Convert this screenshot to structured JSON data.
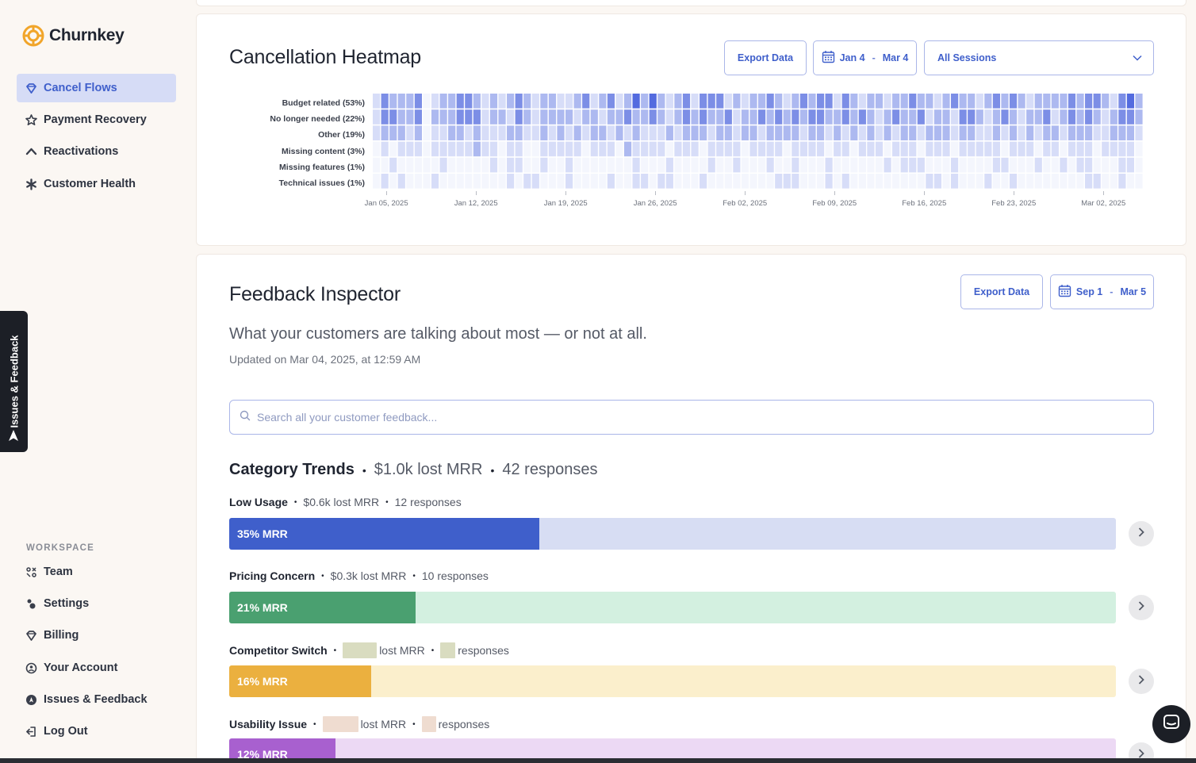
{
  "app": {
    "name": "Churnkey"
  },
  "sidebar": {
    "items": [
      {
        "label": "Cancel Flows",
        "icon": "diamond-icon",
        "active": true
      },
      {
        "label": "Payment Recovery",
        "icon": "star-badge-icon"
      },
      {
        "label": "Reactivations",
        "icon": "arrow-up-icon"
      },
      {
        "label": "Customer Health",
        "icon": "asterisk-icon"
      }
    ],
    "workspace_label": "WORKSPACE",
    "workspace_items": [
      {
        "label": "Team",
        "icon": "team-icon"
      },
      {
        "label": "Settings",
        "icon": "settings-icon"
      },
      {
        "label": "Billing",
        "icon": "gem-icon"
      },
      {
        "label": "Your Account",
        "icon": "account-icon"
      },
      {
        "label": "Issues & Feedback",
        "icon": "feedback-icon"
      },
      {
        "label": "Log Out",
        "icon": "logout-icon"
      }
    ]
  },
  "feedback_tab": {
    "label": "Issues & Feedback"
  },
  "heatmap": {
    "title": "Cancellation Heatmap",
    "export_label": "Export Data",
    "date_from": "Jan 4",
    "date_sep": "-",
    "date_to": "Mar 4",
    "sessions_value": "All Sessions",
    "accent": "#4a63dd"
  },
  "chart_data": {
    "type": "heatmap",
    "rows": [
      "Budget related (53%)",
      "No longer needed (22%)",
      "Other (19%)",
      "Missing content (3%)",
      "Missing features (1%)",
      "Technical issues (1%)"
    ],
    "x_ticks": [
      "Jan 05, 2025",
      "Jan 12, 2025",
      "Jan 19, 2025",
      "Jan 26, 2025",
      "Feb 02, 2025",
      "Feb 09, 2025",
      "Feb 16, 2025",
      "Feb 23, 2025",
      "Mar 02, 2025"
    ],
    "x_start": "Jan 04, 2025",
    "x_end": "Mar 04, 2025",
    "values": [
      [
        1,
        3,
        2,
        2,
        2,
        3,
        0,
        1,
        2,
        2,
        3,
        3,
        2,
        1,
        2,
        1,
        2,
        3,
        2,
        1,
        2,
        2,
        1,
        1,
        2,
        3,
        1,
        2,
        3,
        1,
        2,
        4,
        2,
        4,
        2,
        1,
        2,
        3,
        1,
        3,
        3,
        3,
        1,
        2,
        1,
        2,
        2,
        3,
        2,
        1,
        2,
        3,
        2,
        3,
        3,
        1,
        3,
        2,
        1,
        2,
        2,
        1,
        2,
        2,
        3,
        2,
        2,
        1,
        2,
        3,
        2,
        2,
        1,
        2,
        3,
        2,
        3,
        2,
        1,
        2,
        2,
        2,
        2,
        3,
        2,
        3,
        3,
        2,
        1,
        3,
        4,
        2
      ],
      [
        1,
        3,
        3,
        2,
        2,
        3,
        0,
        2,
        2,
        2,
        3,
        3,
        3,
        1,
        2,
        2,
        1,
        3,
        2,
        1,
        2,
        2,
        2,
        2,
        1,
        2,
        2,
        1,
        2,
        2,
        3,
        2,
        2,
        3,
        2,
        1,
        2,
        3,
        2,
        3,
        2,
        2,
        3,
        1,
        2,
        2,
        3,
        2,
        3,
        2,
        3,
        2,
        3,
        3,
        2,
        2,
        3,
        2,
        3,
        2,
        1,
        2,
        3,
        2,
        2,
        3,
        1,
        2,
        2,
        1,
        3,
        3,
        2,
        1,
        2,
        3,
        2,
        1,
        2,
        2,
        3,
        1,
        2,
        3,
        2,
        3,
        2,
        1,
        2,
        3,
        3,
        2
      ],
      [
        1,
        2,
        2,
        2,
        1,
        2,
        0,
        1,
        1,
        2,
        2,
        1,
        2,
        1,
        1,
        1,
        2,
        2,
        1,
        1,
        2,
        1,
        2,
        1,
        2,
        1,
        2,
        2,
        1,
        2,
        1,
        2,
        1,
        1,
        1,
        2,
        1,
        2,
        2,
        2,
        1,
        2,
        2,
        1,
        2,
        2,
        1,
        2,
        2,
        2,
        2,
        1,
        2,
        2,
        1,
        2,
        1,
        2,
        1,
        2,
        1,
        2,
        1,
        2,
        2,
        1,
        2,
        2,
        2,
        1,
        2,
        2,
        1,
        1,
        2,
        1,
        2,
        1,
        2,
        1,
        2,
        2,
        1,
        2,
        2,
        2,
        1,
        1,
        2,
        2,
        2,
        1
      ],
      [
        0,
        1,
        0,
        1,
        1,
        1,
        0,
        1,
        1,
        1,
        1,
        1,
        2,
        1,
        1,
        0,
        1,
        1,
        0,
        0,
        1,
        1,
        1,
        1,
        1,
        0,
        1,
        1,
        1,
        0,
        2,
        1,
        1,
        1,
        1,
        0,
        1,
        1,
        1,
        0,
        1,
        1,
        1,
        1,
        0,
        1,
        1,
        1,
        1,
        0,
        1,
        1,
        1,
        1,
        0,
        1,
        1,
        0,
        1,
        1,
        1,
        0,
        1,
        1,
        1,
        0,
        1,
        1,
        1,
        0,
        1,
        1,
        1,
        1,
        1,
        0,
        1,
        1,
        1,
        0,
        1,
        1,
        0,
        1,
        1,
        1,
        0,
        1,
        1,
        1,
        1,
        0
      ],
      [
        0,
        0,
        1,
        0,
        0,
        0,
        0,
        0,
        1,
        0,
        0,
        0,
        0,
        0,
        1,
        0,
        1,
        1,
        0,
        0,
        1,
        0,
        0,
        1,
        0,
        0,
        0,
        0,
        0,
        0,
        0,
        1,
        0,
        0,
        0,
        1,
        0,
        0,
        0,
        0,
        1,
        0,
        0,
        1,
        0,
        0,
        0,
        1,
        0,
        0,
        1,
        0,
        0,
        0,
        1,
        0,
        0,
        0,
        0,
        0,
        0,
        1,
        0,
        1,
        1,
        1,
        0,
        0,
        0,
        1,
        0,
        0,
        0,
        0,
        1,
        1,
        0,
        0,
        0,
        1,
        0,
        0,
        1,
        0,
        1,
        1,
        0,
        0,
        0,
        1,
        1,
        0
      ],
      [
        0,
        1,
        0,
        1,
        0,
        0,
        0,
        1,
        0,
        0,
        0,
        0,
        0,
        0,
        0,
        0,
        1,
        0,
        1,
        1,
        0,
        0,
        0,
        1,
        0,
        0,
        0,
        0,
        1,
        0,
        0,
        1,
        1,
        0,
        1,
        1,
        0,
        0,
        0,
        1,
        0,
        0,
        0,
        0,
        0,
        0,
        0,
        0,
        1,
        1,
        1,
        0,
        0,
        0,
        1,
        0,
        1,
        0,
        0,
        0,
        0,
        0,
        0,
        0,
        0,
        0,
        1,
        1,
        0,
        1,
        0,
        0,
        0,
        1,
        0,
        0,
        1,
        0,
        0,
        0,
        0,
        0,
        0,
        0,
        0,
        1,
        1,
        0,
        0,
        1,
        0,
        0
      ]
    ]
  },
  "inspector": {
    "title": "Feedback Inspector",
    "export_label": "Export Data",
    "date_from": "Sep 1",
    "date_sep": "-",
    "date_to": "Mar 5",
    "subtitle": "What your customers are talking about most — or not at all.",
    "updated": "Updated on Mar 04, 2025, at 12:59 AM",
    "search_placeholder": "Search all your customer feedback..."
  },
  "trends": {
    "title": "Category Trends",
    "bullet": "•",
    "lost_mrr": "$1.0k lost MRR",
    "responses": "42 responses",
    "categories": [
      {
        "name": "Low Usage",
        "lost_mrr": "$0.6k lost MRR",
        "responses": "12 responses",
        "bar_label": "35% MRR",
        "share": 0.35,
        "fill": "#3f5fcb",
        "track": "#d7ddf3"
      },
      {
        "name": "Pricing Concern",
        "lost_mrr": "$0.3k lost MRR",
        "responses": "10 responses",
        "bar_label": "21% MRR",
        "share": 0.21,
        "fill": "#4aa070",
        "track": "#d3f0e0"
      },
      {
        "name": "Competitor Switch",
        "lost_mrr": "lost MRR",
        "responses": "responses",
        "bar_label": "16% MRR",
        "share": 0.16,
        "fill": "#ebb03f",
        "track": "#fbefcc",
        "redact": "#d9dcc0"
      },
      {
        "name": "Usability Issue",
        "lost_mrr": "lost MRR",
        "responses": "responses",
        "bar_label": "12% MRR",
        "share": 0.12,
        "fill": "#a860cf",
        "track": "#ecd9f4",
        "redact": "#efdcd0"
      }
    ]
  }
}
